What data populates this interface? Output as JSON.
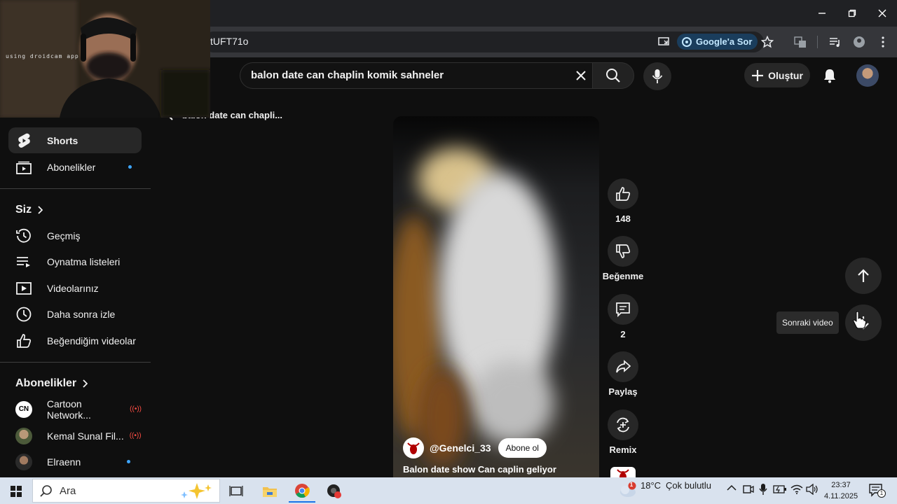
{
  "browser": {
    "url_fragment": "tUFT71o",
    "ask_google_label": "Google'a Sor",
    "window_controls": [
      "minimize-icon",
      "restore-icon",
      "close-icon"
    ]
  },
  "webcam": {
    "overlay_text": "using droidcam app"
  },
  "header": {
    "search_query": "balon date can chaplin komik sahneler",
    "create_label": "Oluştur"
  },
  "sidebar": {
    "items_top": [
      {
        "label": "Shorts",
        "icon": "shorts-icon",
        "active": true
      },
      {
        "label": "Abonelikler",
        "icon": "subscriptions-icon",
        "dot": true
      }
    ],
    "you_section": {
      "title": "Siz",
      "items": [
        {
          "label": "Geçmiş",
          "icon": "history-icon"
        },
        {
          "label": "Oynatma listeleri",
          "icon": "playlists-icon"
        },
        {
          "label": "Videolarınız",
          "icon": "your-videos-icon"
        },
        {
          "label": "Daha sonra izle",
          "icon": "watch-later-icon"
        },
        {
          "label": "Beğendiğim videolar",
          "icon": "liked-videos-icon"
        }
      ]
    },
    "subs_section": {
      "title": "Abonelikler",
      "channels": [
        {
          "label": "Cartoon Network...",
          "live": "((•))"
        },
        {
          "label": "Kemal Sunal Fil...",
          "live": "((•))"
        },
        {
          "label": "Elraenn",
          "dot": true
        }
      ]
    }
  },
  "breadcrumb": "balon date can chapli...",
  "short": {
    "channel": "@Genelci_33",
    "subscribe_label": "Abone ol",
    "title": "Balon date show Can caplin geliyor",
    "actions": {
      "like_count": "148",
      "dislike_label": "Beğenme",
      "comments_count": "2",
      "share_label": "Paylaş",
      "remix_label": "Remix"
    }
  },
  "navigation": {
    "next_tooltip": "Sonraki video"
  },
  "taskbar": {
    "search_placeholder": "Ara",
    "weather_temp": "18°C",
    "weather_desc": "Çok bulutlu",
    "time": "23:37",
    "date": "4.11.2025",
    "notification_count": "1",
    "weather_badge": "1"
  },
  "colors": {
    "accent_blue": "#3ea6ff",
    "live_red": "#ff4e45",
    "page_bg": "#0f0f0f"
  }
}
